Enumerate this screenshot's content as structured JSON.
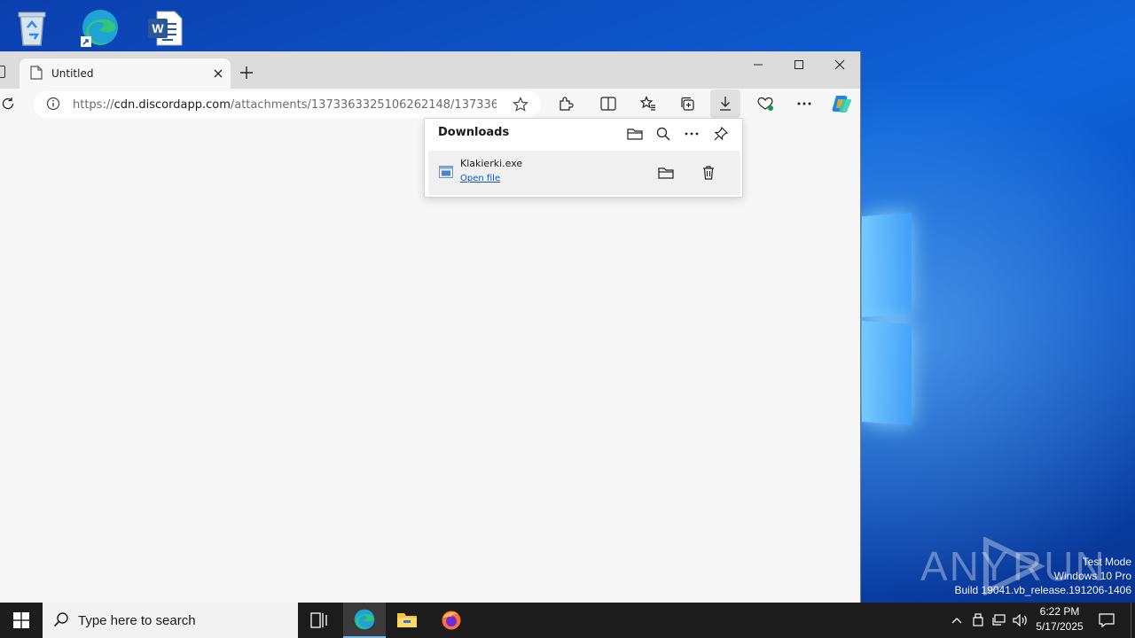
{
  "desktop": {
    "icons": [
      "recycle-bin",
      "microsoft-edge",
      "microsoft-word"
    ],
    "watermark": {
      "logo_text": "ANY RUN",
      "line1": "Test Mode",
      "line2": "Windows 10 Pro",
      "line3": "Build 19041.vb_release.191206-1406"
    }
  },
  "browser": {
    "tab": {
      "title": "Untitled"
    },
    "address": {
      "prefix": "https://",
      "host": "cdn.discordapp.com",
      "path": "/attachments/1373363325106262148/1373363..."
    },
    "downloads_panel": {
      "title": "Downloads",
      "items": [
        {
          "filename": "Klakierki.exe",
          "action": "Open file"
        }
      ]
    }
  },
  "taskbar": {
    "search_placeholder": "Type here to search",
    "clock": {
      "time": "6:22 PM",
      "date": "5/17/2025"
    }
  },
  "colors": {
    "taskbar": "#1c1c1c",
    "browser_bg": "#f7f7f7",
    "link": "#0f5cc0",
    "desktop": "#0e63d8"
  }
}
